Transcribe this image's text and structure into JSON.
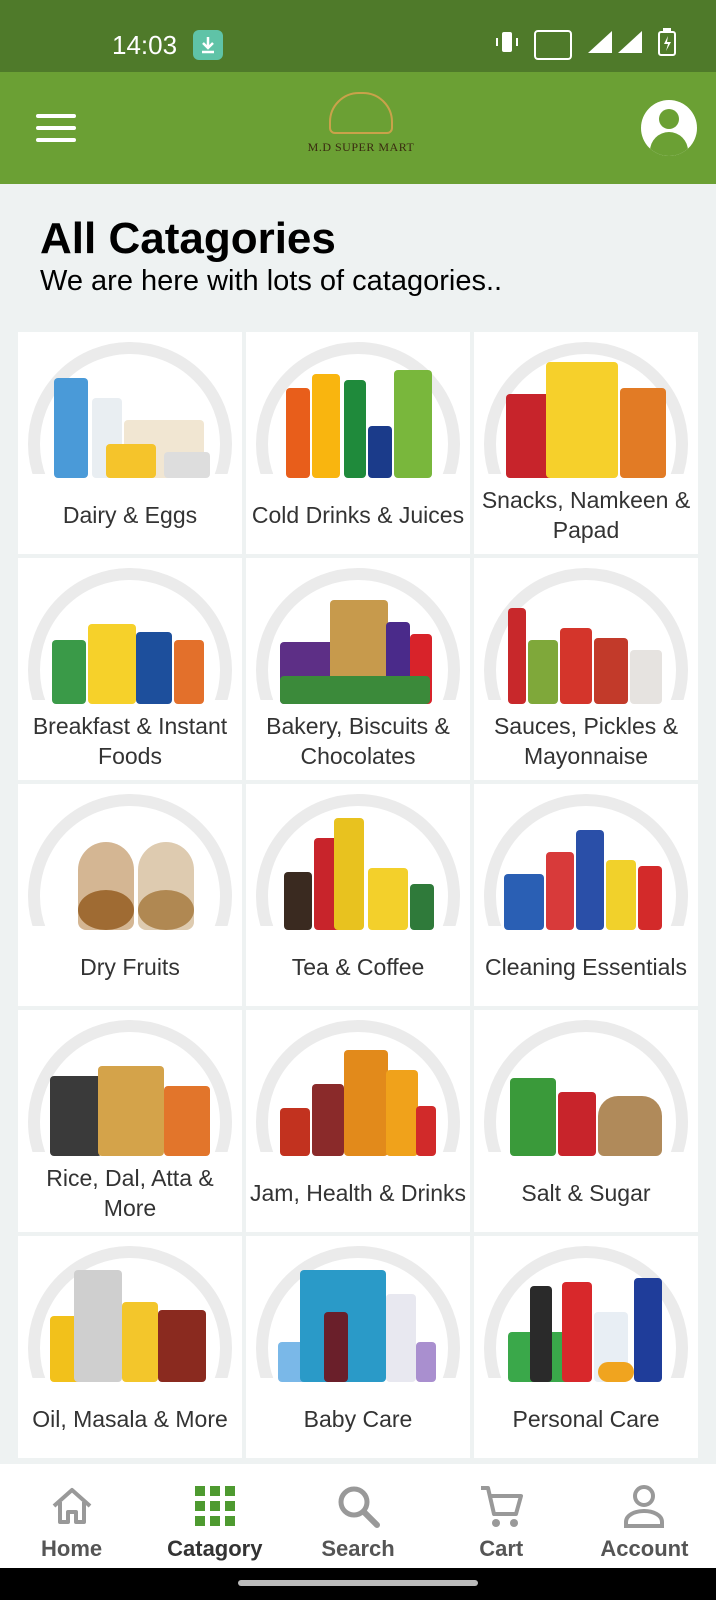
{
  "status_bar": {
    "time": "14:03"
  },
  "header": {
    "brand": "M.D SUPER MART"
  },
  "page": {
    "title": "All Catagories",
    "subtitle": "We are here with lots of catagories.."
  },
  "categories": [
    {
      "label": "Dairy & Eggs"
    },
    {
      "label": "Cold Drinks & Juices"
    },
    {
      "label": "Snacks, Namkeen & Papad"
    },
    {
      "label": "Breakfast & Instant Foods"
    },
    {
      "label": "Bakery, Biscuits & Chocolates"
    },
    {
      "label": "Sauces, Pickles & Mayonnaise"
    },
    {
      "label": "Dry Fruits"
    },
    {
      "label": "Tea & Coffee"
    },
    {
      "label": "Cleaning Essentials"
    },
    {
      "label": "Rice, Dal, Atta & More"
    },
    {
      "label": "Jam, Health & Drinks"
    },
    {
      "label": "Salt & Sugar"
    },
    {
      "label": "Oil, Masala & More"
    },
    {
      "label": "Baby Care"
    },
    {
      "label": "Personal Care"
    }
  ],
  "nav": {
    "home": "Home",
    "category": "Catagory",
    "search": "Search",
    "cart": "Cart",
    "account": "Account"
  },
  "colors": {
    "status_bar": "#4f7a2a",
    "header": "#6ba034",
    "active_icon": "#4e9a30",
    "inactive_icon": "#999999"
  }
}
